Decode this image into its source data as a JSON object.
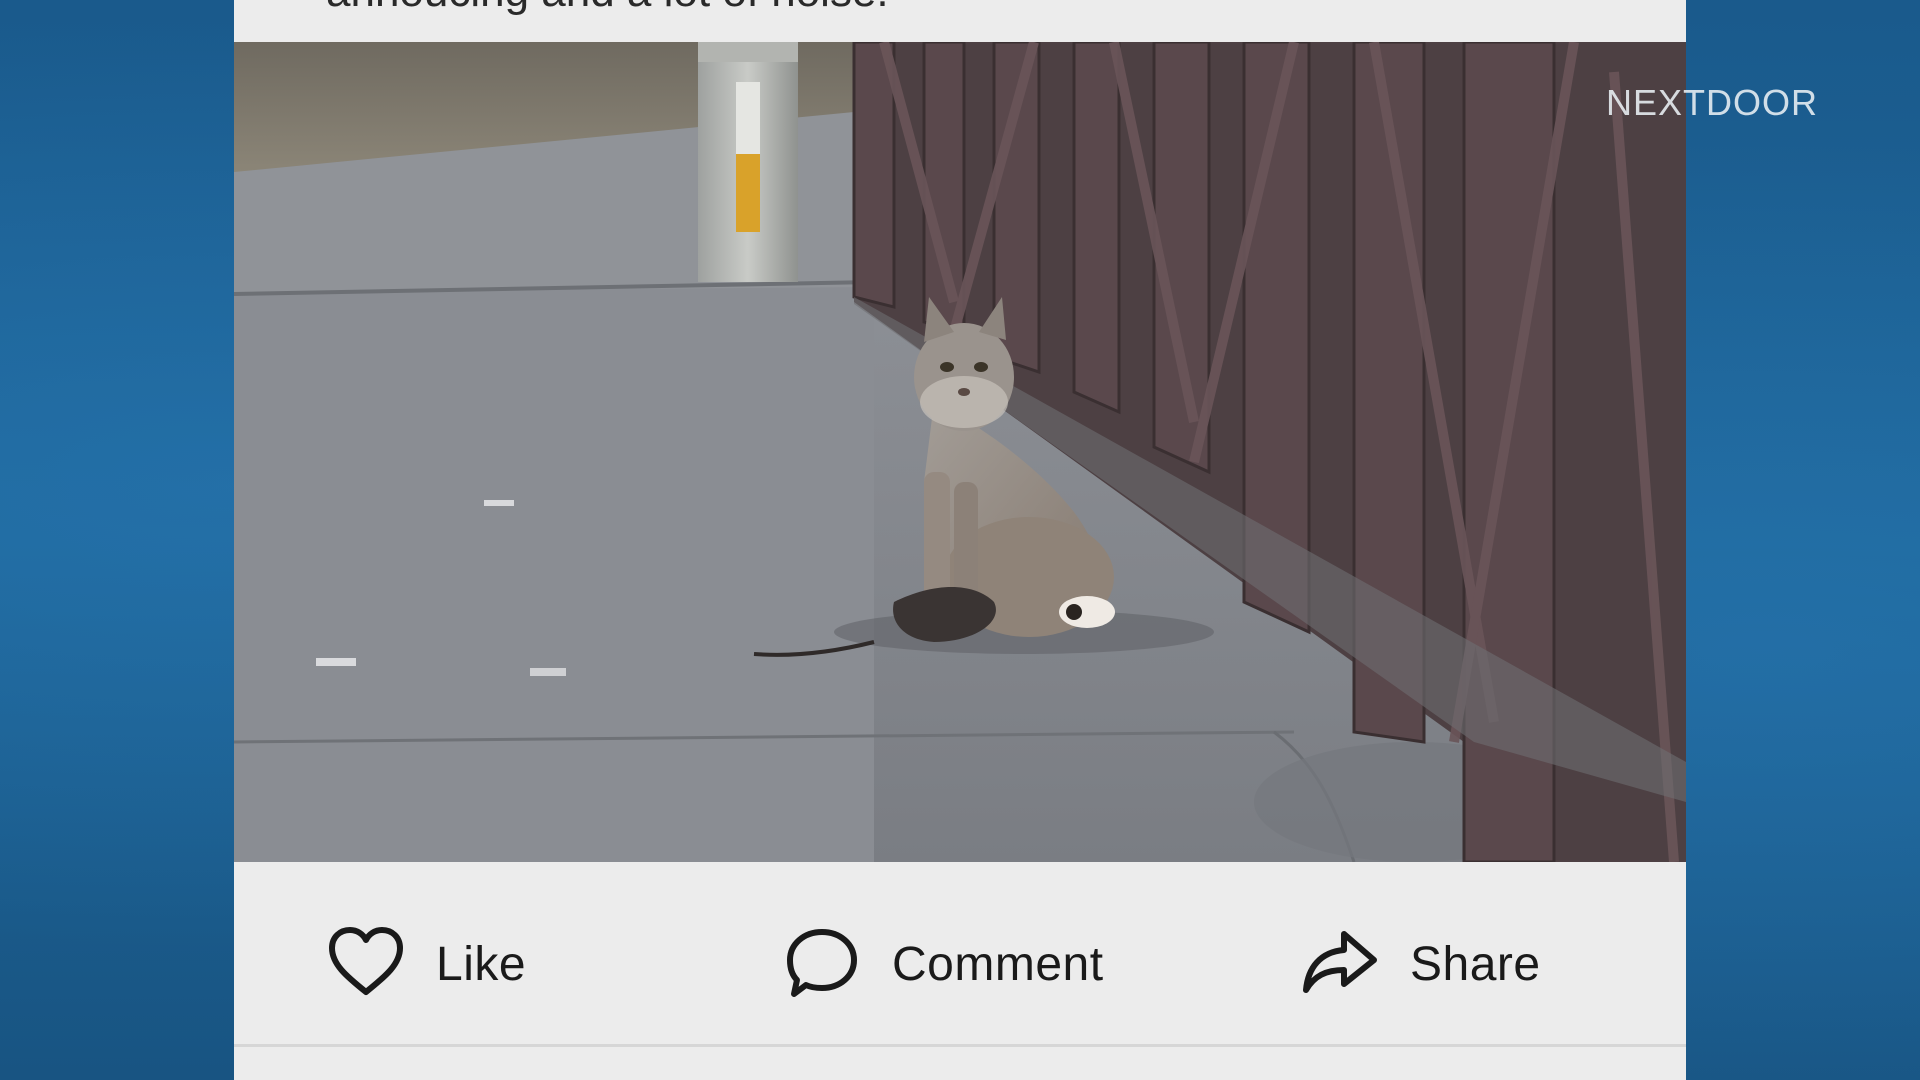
{
  "watermark": {
    "text": "NEXTDOOR"
  },
  "post": {
    "caption_partial": "annoucing and a lot of noise.",
    "photo": {
      "icon": "bobcat-photo"
    },
    "actions": {
      "like_label": "Like",
      "like_icon": "heart-icon",
      "comment_label": "Comment",
      "comment_icon": "speech-bubble-icon",
      "share_label": "Share",
      "share_icon": "share-arrow-icon"
    }
  },
  "colors": {
    "background_blue": "#1b5d8f",
    "card_background": "#ececec",
    "text_dark": "#1a1a1a",
    "railing": "#4a3b40"
  }
}
